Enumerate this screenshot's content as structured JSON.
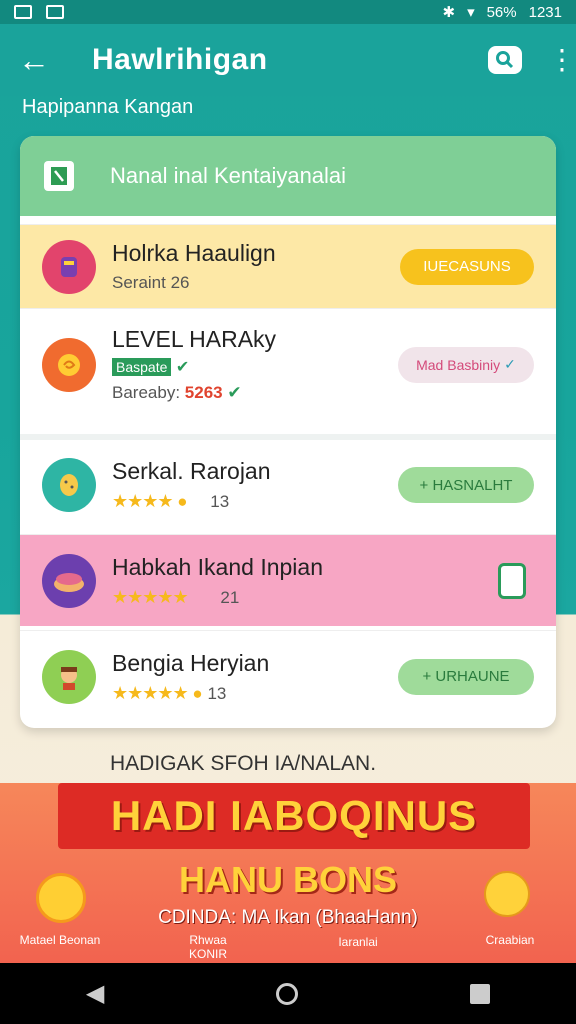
{
  "status": {
    "battery": "56%",
    "time": "1231"
  },
  "appbar": {
    "title": "Hawlrihigan",
    "back": "back-icon",
    "search": "search-icon",
    "more": "more-icon"
  },
  "subtitle": "Hapipanna Kangan",
  "panel": {
    "header": "Nanal inal Kentaiyanalai",
    "rows": [
      {
        "name": "Holrka Haaulign",
        "sub": "Seraint 26",
        "action": "IUECASUNS",
        "bg": "#fde8a6"
      },
      {
        "name": "LEVEL HARAky",
        "tag": "Baspate",
        "sub_prefix": "Bareaby:",
        "sub_value": "5263",
        "action": "Mad Basbiniy",
        "bg": "#ffffff"
      },
      {
        "name": "Serkal. Rarojan",
        "count": "13",
        "action": "HASNALHT",
        "bg": "#ffffff"
      },
      {
        "name": "Habkah Ikand Inpian",
        "count": "21",
        "action": "",
        "bg": "#f7a6c4"
      },
      {
        "name": "Bengia Heryian",
        "count": "13",
        "action": "URHAUNE",
        "bg": "#ffffff"
      }
    ]
  },
  "section_label": "HADIGAK SFOH IA/NALAN.",
  "banner": {
    "title": "HADI IABOQINUS",
    "subtitle": "HANU BONS",
    "tagline": "CDINDA: MA Ikan (BhaaHann)",
    "captions": [
      "Matael Beonan",
      "Rhwaa KONIR",
      "Iaranlai",
      "Craabian"
    ]
  },
  "colors": {
    "teal": "#1aa39b",
    "green": "#7fcf96",
    "yellow": "#f7c21d",
    "pink": "#f7a6c4"
  }
}
